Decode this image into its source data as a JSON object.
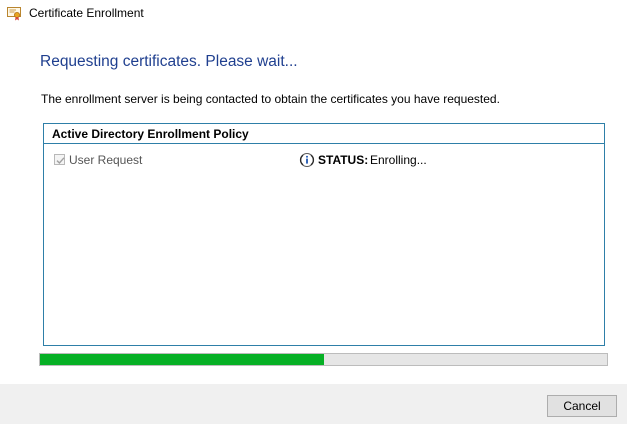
{
  "window": {
    "title": "Certificate Enrollment",
    "icon": "certificate-icon"
  },
  "main": {
    "heading": "Requesting certificates. Please wait...",
    "description": "The enrollment server is being contacted to obtain the certificates you have requested."
  },
  "policy": {
    "title": "Active Directory Enrollment Policy",
    "items": [
      {
        "label": "User Request",
        "checked": true,
        "status_icon": "info-icon",
        "status_label": "STATUS:",
        "status_value": "Enrolling..."
      }
    ]
  },
  "progress": {
    "fraction": 0.5,
    "color": "#06b025"
  },
  "footer": {
    "cancel_label": "Cancel"
  },
  "colors": {
    "heading": "#1f3f8f",
    "policy_border": "#2e7fa8",
    "footer_bg": "#f0f0f0"
  }
}
